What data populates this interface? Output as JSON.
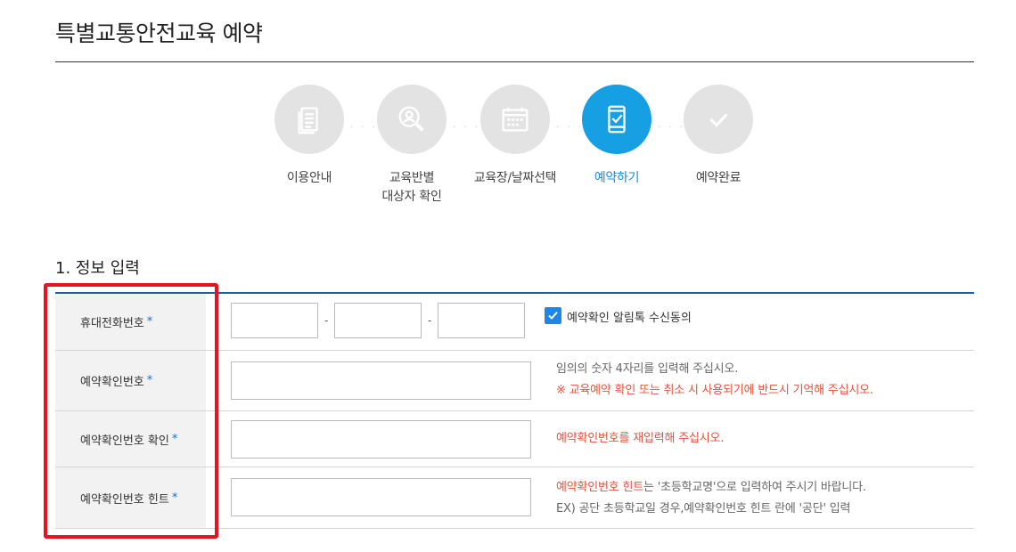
{
  "page": {
    "title": "특별교통안전교육 예약"
  },
  "steps": [
    {
      "label_line1": "이용안내",
      "label_line2": "",
      "icon": "document-icon",
      "active": false
    },
    {
      "label_line1": "교육반별",
      "label_line2": "대상자 확인",
      "icon": "search-person-icon",
      "active": false
    },
    {
      "label_line1": "교육장/날짜선택",
      "label_line2": "",
      "icon": "calendar-icon",
      "active": false
    },
    {
      "label_line1": "예약하기",
      "label_line2": "",
      "icon": "phone-check-icon",
      "active": true
    },
    {
      "label_line1": "예약완료",
      "label_line2": "",
      "icon": "check-icon",
      "active": false
    }
  ],
  "step_separator": "· · ·",
  "section": {
    "title": "1. 정보 입력"
  },
  "form": {
    "phone": {
      "label": "휴대전화번호",
      "required": "*",
      "separator": "-",
      "agree_label": "예약확인 알림톡 수신동의",
      "agree_checked": true
    },
    "pin": {
      "label": "예약확인번호",
      "required": "*",
      "help1": "임의의 숫자 4자리를 입력해 주십시오.",
      "help2": "※ 교육예약 확인 또는 취소 시 사용되기에 반드시 기억해 주십시오."
    },
    "pin_confirm": {
      "label": "예약확인번호 확인",
      "required": "*",
      "help": "예약확인번호를 재입력해 주십시오."
    },
    "pin_hint": {
      "label": "예약확인번호 힌트",
      "required": "*",
      "help1_red": "예약확인번호 힌트",
      "help1_rest": "는 '초등학교명'으로 입력하여 주시기 바랍니다.",
      "help2": "EX) 공단 초등학교일 경우,예약확인번호 힌트 란에 '공단' 입력"
    }
  },
  "colors": {
    "accent": "#169fe3",
    "required": "#1c6cd6",
    "warning": "#e2533b",
    "highlight": "#e8141d",
    "rule": "#1f5fa8"
  }
}
